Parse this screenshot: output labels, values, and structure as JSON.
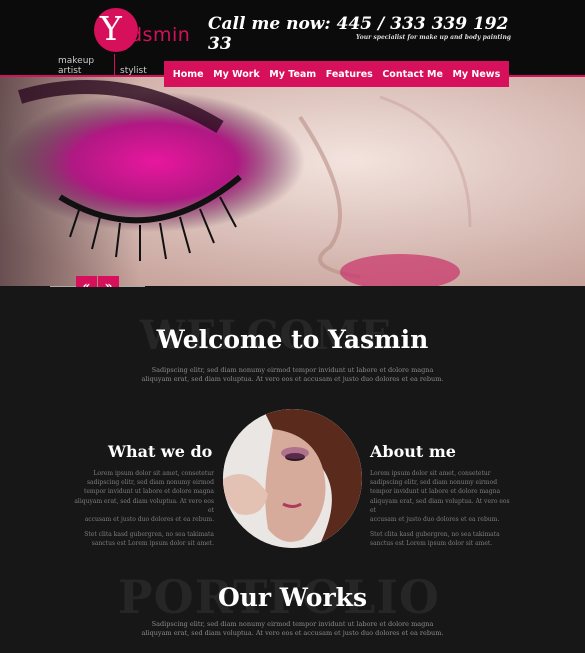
{
  "brand": {
    "logo_initial": "Y",
    "logo_rest": "dsmin",
    "tag_makeup": "makeup",
    "tag_artist": "artist",
    "tag_stylist": "stylist"
  },
  "contact": {
    "call_label": "Call me now: 445 / 333 339 192 33",
    "subtitle": "Your specialist for make up and body painting"
  },
  "nav": {
    "items": [
      {
        "label": "Home"
      },
      {
        "label": "My Work"
      },
      {
        "label": "My Team"
      },
      {
        "label": "Features"
      },
      {
        "label": "Contact Me"
      },
      {
        "label": "My News"
      }
    ]
  },
  "slider": {
    "prev_label": "«",
    "next_label": "»"
  },
  "welcome": {
    "ghost_text": "WELCOME",
    "title": "Welcome to Yasmin",
    "line1": "Sadipscing elitr, sed diam nonumy eirmod tempor invidunt ut labore et dolore magna",
    "line2": "aliquyam erat, sed diam voluptua. At vero eos et accusam et justo duo dolores et ea rebum."
  },
  "what_we_do": {
    "title": "What we do",
    "p1_l1": "Lorem ipsum dolor sit amet, consetetur",
    "p1_l2": "sadipscing elitr, sed diam nonumy eirmod",
    "p1_l3": "tempor invidunt ut labore et dolore magna",
    "p1_l4": "aliquyam erat, sed diam voluptua. At vero eos et",
    "p1_l5": "accusam et justo duo dolores et ea rebum.",
    "p2_l1": "Stet clita kasd gubergren, no sea takimata",
    "p2_l2": "sanctus est Lorem ipsum dolor sit amet."
  },
  "about_me": {
    "title": "About me",
    "p1_l1": "Lorem ipsum dolor sit amet, consetetur",
    "p1_l2": "sadipscing elitr, sed diam nonumy eirmod",
    "p1_l3": "tempor invidunt ut labore et dolore magna",
    "p1_l4": "aliquyam erat, sed diam voluptua. At vero eos et",
    "p1_l5": "accusam et justo duo dolores et ea rebum.",
    "p2_l1": "Stet clita kasd gubergren, no sea takimata",
    "p2_l2": "sanctus est Lorem ipsum dolor sit amet."
  },
  "works": {
    "ghost_text": "PORTFOLIO",
    "title": "Our Works",
    "line1": "Sadipscing elitr, sed diam nonumy eirmod tempor invidunt ut labore et dolore magna",
    "line2": "aliquyam erat, sed diam voluptua. At vero eos et accusam et justo duo dolores et ea rebum."
  },
  "colors": {
    "accent": "#d6105a",
    "background": "#171717",
    "header": "#0b0b0b"
  }
}
